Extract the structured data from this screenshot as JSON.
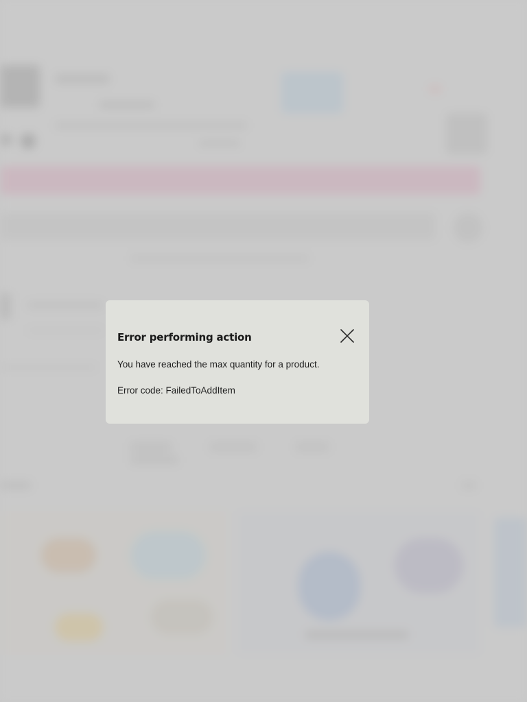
{
  "dialog": {
    "title": "Error performing action",
    "message": "You have reached the max quantity for a product.",
    "error_code": "Error code: FailedToAddItem",
    "close_icon": "close-icon"
  },
  "colors": {
    "dialog_background": "#e0e1dc",
    "scrim": "#c8c8c8",
    "text": "#1a1a1a"
  }
}
